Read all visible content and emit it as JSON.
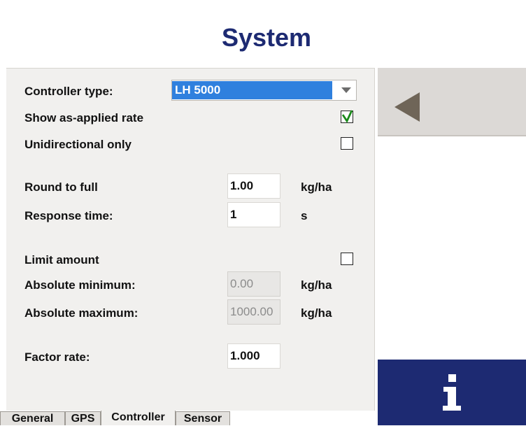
{
  "header": {
    "title": "System"
  },
  "controller": {
    "type_label": "Controller type:",
    "type_value": "LH 5000",
    "show_rate_label": "Show as-applied rate",
    "show_rate_checked": true,
    "unidirectional_label": "Unidirectional only",
    "unidirectional_checked": false,
    "round_label": "Round to full",
    "round_value": "1.00",
    "round_unit": "kg/ha",
    "response_label": "Response time:",
    "response_value": "1",
    "response_unit": "s",
    "limit_label": "Limit amount",
    "limit_checked": false,
    "abs_min_label": "Absolute minimum:",
    "abs_min_value": "0.00",
    "abs_min_unit": "kg/ha",
    "abs_max_label": "Absolute maximum:",
    "abs_max_value": "1000.00",
    "abs_max_unit": "kg/ha",
    "factor_label": "Factor rate:",
    "factor_value": "1.000"
  },
  "tabs": [
    {
      "label": "General",
      "active": false
    },
    {
      "label": "GPS",
      "active": false
    },
    {
      "label": "Controller",
      "active": true
    },
    {
      "label": "Sensor",
      "active": false
    }
  ],
  "sidebar": {
    "back_icon": "left-triangle-icon",
    "info_icon": "info-icon"
  },
  "colors": {
    "brand_navy": "#1d2a72",
    "selection_blue": "#2f80de",
    "check_green": "#1a8a1a",
    "panel_bg": "#f1f0ee"
  }
}
